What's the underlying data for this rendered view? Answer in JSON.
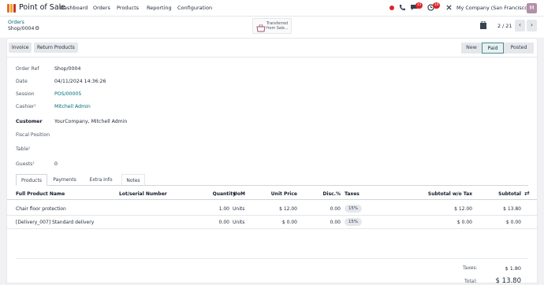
{
  "topbar": {
    "app_name": "Point of Sale",
    "menu": [
      "Dashboard",
      "Orders",
      "Products",
      "Reporting",
      "Configuration"
    ],
    "icons": [
      "phone-icon",
      "chat-icon",
      "clock-icon",
      "wrench-icon"
    ],
    "chat_badge": "15",
    "activity_badge": "10",
    "company": "My Company (San Francisco)",
    "avatar_initial": "M",
    "status_color": "#dc2626",
    "badge_color": "#dc2626"
  },
  "control": {
    "breadcrumb_parent": "Orders",
    "record_name": "Shop/0004",
    "stamp_text": "Transferred from Sale...",
    "pager": "2 / 21"
  },
  "actions": {
    "invoice": "Invoice",
    "return_products": "Return Products",
    "stages": [
      "New",
      "Paid",
      "Posted"
    ],
    "active_stage": "Paid"
  },
  "fields": {
    "order_ref_label": "Order Ref",
    "order_ref": "Shop/0004",
    "date_label": "Date",
    "date": "04/11/2024 14:36:26",
    "session_label": "Session",
    "session": "POS/00005",
    "cashier_label": "Cashier",
    "cashier": "Mitchell Admin",
    "customer_label": "Customer",
    "customer": "YourCompany, Mitchell Admin",
    "fiscal_label": "Fiscal Position",
    "table_label": "Table",
    "guests_label": "Guests",
    "guests": "0",
    "help_mark": "?"
  },
  "tabs": [
    "Products",
    "Payments",
    "Extra Info",
    "Notes"
  ],
  "table": {
    "headers": [
      "Full Product Name",
      "Lot/serial Number",
      "Quantity",
      "UoM",
      "Unit Price",
      "Disc.%",
      "Taxes",
      "Subtotal w/o Tax",
      "Subtotal"
    ],
    "settings_icon": "⇄",
    "rows": [
      {
        "name": "Chair floor protection",
        "lot": "",
        "qty": "1.00",
        "uom": "Units",
        "price": "$ 12.00",
        "disc": "0.00",
        "tax": "15%",
        "subtotal_wo": "$ 12.00",
        "subtotal": "$ 13.80"
      },
      {
        "name": "[Delivery_007] Standard delivery",
        "lot": "",
        "qty": "0.00",
        "uom": "Units",
        "price": "$ 0.00",
        "disc": "0.00",
        "tax": "15%",
        "subtotal_wo": "$ 0.00",
        "subtotal": "$ 0.00"
      }
    ]
  },
  "totals": {
    "taxes_label": "Taxes:",
    "taxes": "$ 1.80",
    "total_label": "Total:",
    "total": "$ 13.80"
  },
  "colors": {
    "accent": "#016b73",
    "brand": "#714b67"
  }
}
